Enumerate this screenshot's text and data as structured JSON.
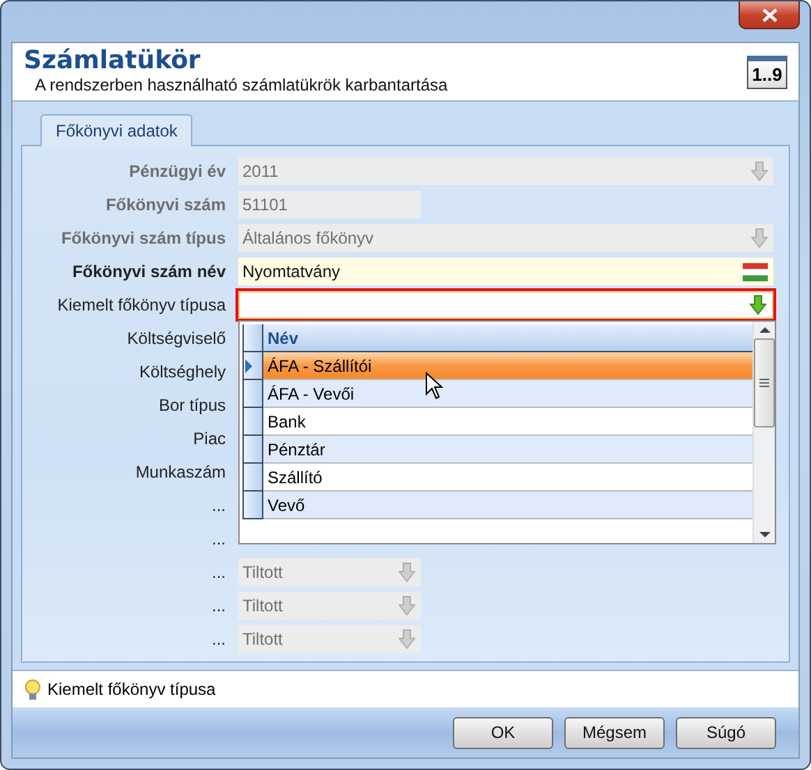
{
  "header": {
    "title": "Számlatükör",
    "subtitle": "A rendszerben használható számlatükrök karbantartása",
    "badge": "1..9"
  },
  "tabs": [
    {
      "label": "Főkönyvi adatok",
      "selected": true
    }
  ],
  "form": [
    {
      "label": "Pénzügyi év",
      "bold": true,
      "disabled": true,
      "field": {
        "kind": "combo",
        "value": "2011",
        "disabled": true,
        "focused": false
      }
    },
    {
      "label": "Főkönyvi szám",
      "bold": true,
      "disabled": true,
      "field": {
        "kind": "short-text",
        "value": "51101",
        "disabled": true,
        "focused": false
      }
    },
    {
      "label": "Főkönyvi szám típus",
      "bold": true,
      "disabled": true,
      "field": {
        "kind": "combo",
        "value": "Általános főkönyv",
        "disabled": true,
        "focused": false
      }
    },
    {
      "label": "Főkönyvi szám név",
      "bold": true,
      "disabled": false,
      "field": {
        "kind": "flag-text",
        "value": "Nyomtatvány",
        "disabled": false,
        "focused": false
      }
    },
    {
      "label": "Kiemelt főkönyv típusa",
      "bold": false,
      "disabled": false,
      "field": {
        "kind": "combo",
        "disabled": false,
        "focused": true
      }
    },
    {
      "label": "Költségviselő",
      "bold": false,
      "disabled": false
    },
    {
      "label": "Költséghely",
      "bold": false,
      "disabled": false
    },
    {
      "label": "Bor típus",
      "bold": false,
      "disabled": false
    },
    {
      "label": "Piac",
      "bold": false,
      "disabled": false
    },
    {
      "label": "Munkaszám",
      "bold": false,
      "disabled": false
    },
    {
      "label": "...",
      "bold": false,
      "disabled": false
    },
    {
      "label": "...",
      "bold": false,
      "disabled": false
    },
    {
      "label": "...",
      "bold": false,
      "disabled": false,
      "field": {
        "kind": "short-combo",
        "value": "Tiltott",
        "disabled": true,
        "focused": false
      }
    },
    {
      "label": "...",
      "bold": false,
      "disabled": false,
      "field": {
        "kind": "short-combo",
        "value": "Tiltott",
        "disabled": true,
        "focused": false
      }
    },
    {
      "label": "...",
      "bold": false,
      "disabled": false,
      "field": {
        "kind": "short-combo",
        "value": "Tiltott",
        "disabled": true,
        "focused": false
      }
    }
  ],
  "dropdown": {
    "columns": [
      "Név"
    ],
    "rows": [
      {
        "name": "ÁFA - Szállítói",
        "selected": true
      },
      {
        "name": "ÁFA - Vevői",
        "selected": false
      },
      {
        "name": "Bank",
        "selected": false
      },
      {
        "name": "Pénztár",
        "selected": false
      },
      {
        "name": "Szállító",
        "selected": false
      },
      {
        "name": "Vevő",
        "selected": false
      }
    ]
  },
  "hint": "Kiemelt főkönyv típusa",
  "buttons": [
    "OK",
    "Mégsem",
    "Súgó"
  ]
}
